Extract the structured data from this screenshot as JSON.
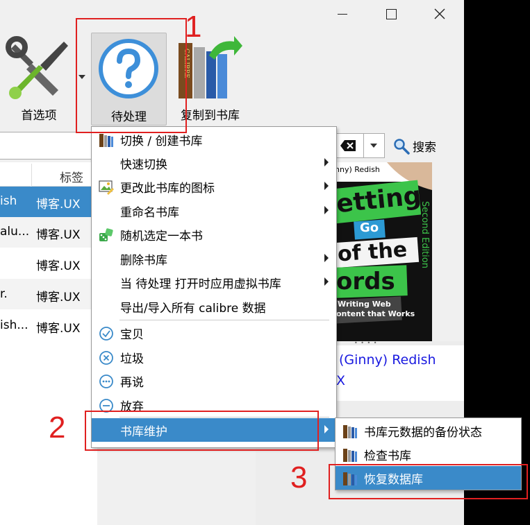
{
  "toolbar": {
    "preferences_label": "首选项",
    "pending_label": "待处理",
    "copy_to_library_label": "复制到书库",
    "calibre_spine_text": "CALIBRE"
  },
  "search": {
    "search_label": "搜索"
  },
  "book_list": {
    "tags_header": "标签",
    "rows": [
      {
        "title": "ish",
        "tag": "博客.UX",
        "selected": true
      },
      {
        "title": "alu...",
        "tag": "博客.UX",
        "selected": false
      },
      {
        "title": "",
        "tag": "博客.UX",
        "selected": false
      },
      {
        "title": "r.",
        "tag": "博客.UX",
        "selected": false
      },
      {
        "title": "ish...",
        "tag": "博客.UX",
        "selected": false
      }
    ]
  },
  "cover": {
    "author_top": "nny) Redish",
    "line1": "etting",
    "line2": "Go",
    "line3": "of the",
    "line4": "ords",
    "edition": "Second Edition",
    "sub1": "Writing Web",
    "sub2": "ontent that Works"
  },
  "details": {
    "author_link": "(Ginny) Redish",
    "tag_link": "X"
  },
  "library_menu": {
    "items": [
      {
        "label": "切换 / 创建书库",
        "icon": "library-books-icon"
      },
      {
        "label": "快速切换",
        "submenu": true
      },
      {
        "label": "更改此书库的图标",
        "icon": "image-edit-icon",
        "submenu": true
      },
      {
        "label": "重命名书库",
        "submenu": true
      },
      {
        "label": "随机选定一本书",
        "icon": "dice-icon"
      },
      {
        "label": "删除书库",
        "submenu": true
      },
      {
        "label": "当 待处理 打开时应用虚拟书库",
        "submenu": true
      },
      {
        "label": "导出/导入所有 calibre 数据"
      },
      {
        "label": "宝贝",
        "icon": "check-circle-icon"
      },
      {
        "label": "垃圾",
        "icon": "x-circle-icon"
      },
      {
        "label": "再说",
        "icon": "dots-circle-icon"
      },
      {
        "label": "放弃",
        "icon": "minus-circle-icon"
      },
      {
        "label": "书库维护",
        "submenu": true,
        "selected": true
      }
    ]
  },
  "maintenance_submenu": {
    "items": [
      {
        "label": "书库元数据的备份状态"
      },
      {
        "label": "检查书库"
      },
      {
        "label": "恢复数据库",
        "selected": true
      }
    ]
  },
  "callouts": {
    "one": "1",
    "two": "2",
    "three": "3"
  },
  "colors": {
    "accent": "#3a8ac9",
    "callout_red": "#e02020"
  }
}
